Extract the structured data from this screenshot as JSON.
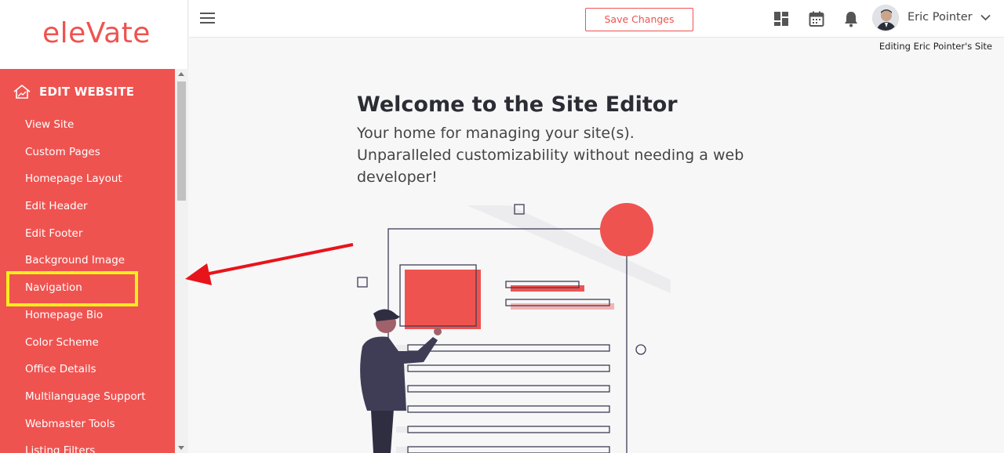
{
  "logo": {
    "text": "eleVate"
  },
  "sidebar": {
    "header": "EDIT WEBSITE",
    "items": [
      {
        "label": "View Site"
      },
      {
        "label": "Custom Pages"
      },
      {
        "label": "Homepage Layout"
      },
      {
        "label": "Edit Header"
      },
      {
        "label": "Edit Footer"
      },
      {
        "label": "Background Image"
      },
      {
        "label": "Navigation"
      },
      {
        "label": "Homepage Bio"
      },
      {
        "label": "Color Scheme"
      },
      {
        "label": "Office Details"
      },
      {
        "label": "Multilanguage Support"
      },
      {
        "label": "Webmaster Tools"
      },
      {
        "label": "Listing Filters"
      }
    ],
    "highlighted_item": "Navigation"
  },
  "topbar": {
    "save_label": "Save Changes",
    "user_name": "Eric Pointer",
    "icons": [
      "menu-icon",
      "dashboard-icon",
      "calendar-icon",
      "bell-icon",
      "chevron-down-icon"
    ]
  },
  "editing_note": "Editing Eric Pointer's Site",
  "main": {
    "title": "Welcome to the Site Editor",
    "subtitle_line1": "Your home for managing your site(s).",
    "subtitle_line2": "Unparalleled customizability without needing a web developer!"
  },
  "colors": {
    "brand": "#ef5350",
    "highlight": "#f6ee1b",
    "annotation_arrow": "#e8141b",
    "text_dark": "#2c2c34"
  }
}
